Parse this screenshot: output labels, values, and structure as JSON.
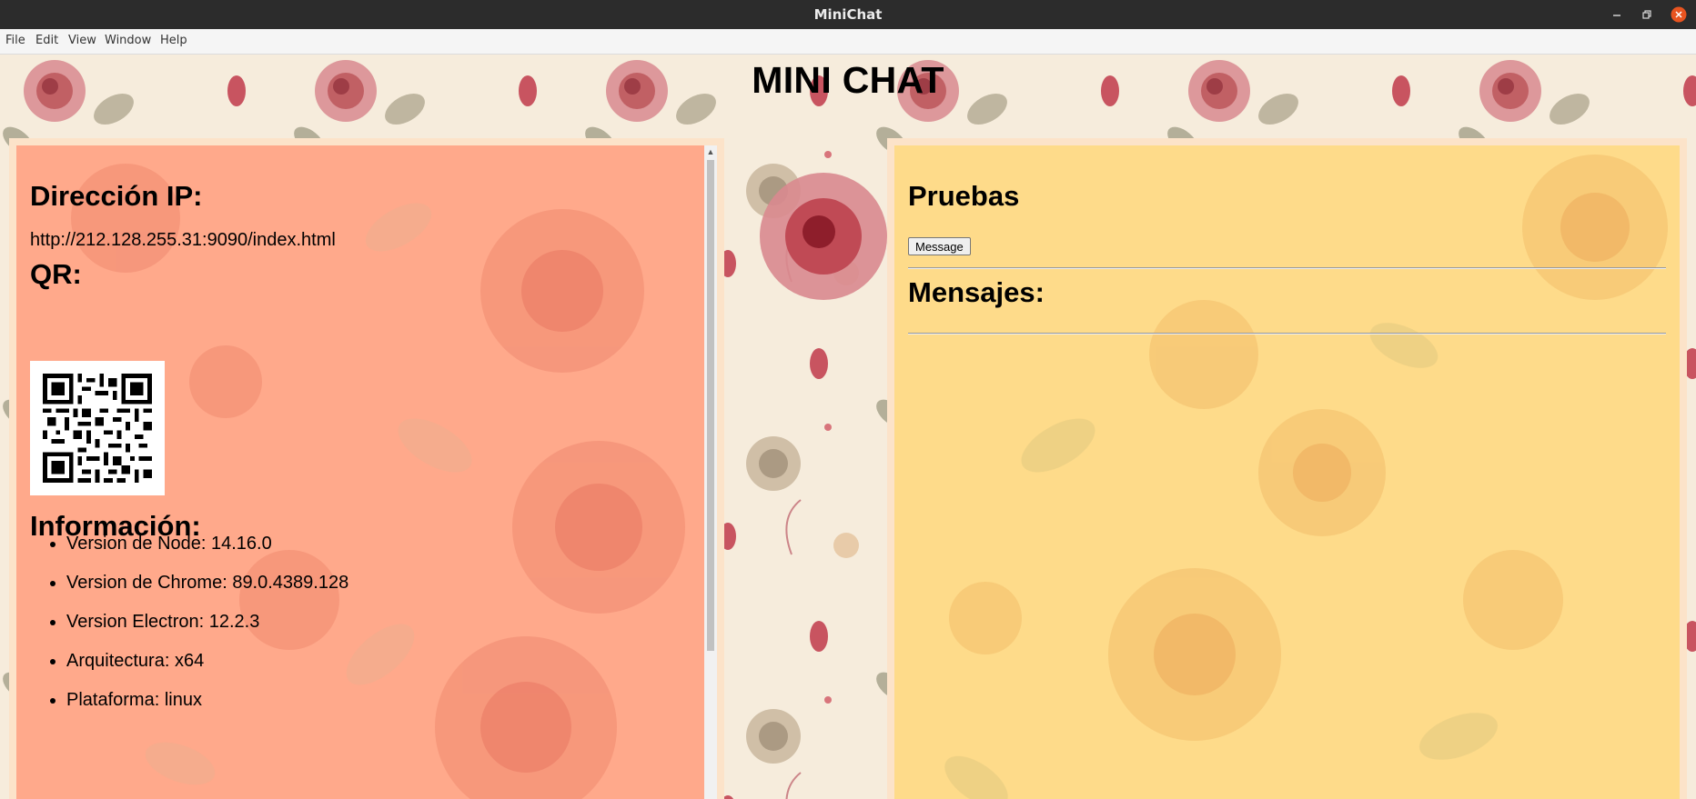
{
  "window": {
    "title": "MiniChat",
    "menu": [
      "File",
      "Edit",
      "View",
      "Window",
      "Help"
    ]
  },
  "app": {
    "title": "MINI CHAT"
  },
  "left_panel": {
    "ip_heading": "Dirección IP:",
    "ip_url": "http://212.128.255.31:9090/index.html",
    "qr_heading": "QR:",
    "info_heading": "Información:",
    "info_items": [
      "Version de Node: 14.16.0",
      "Version de Chrome: 89.0.4389.128",
      "Version Electron: 12.2.3",
      "Arquitectura: x64",
      "Plataforma: linux"
    ]
  },
  "right_panel": {
    "tests_heading": "Pruebas",
    "message_button": "Message",
    "messages_heading": "Mensajes:"
  },
  "colors": {
    "left_panel_bg": "#ffa98b",
    "right_panel_bg": "#fedb8a",
    "panel_border": "#fce3c9",
    "titlebar": "#2c2c2c",
    "close_button": "#e95420"
  },
  "icons": [
    "minimize-icon",
    "maximize-icon",
    "close-icon",
    "qr-code",
    "scroll-up-arrow",
    "scroll-down-arrow"
  ]
}
